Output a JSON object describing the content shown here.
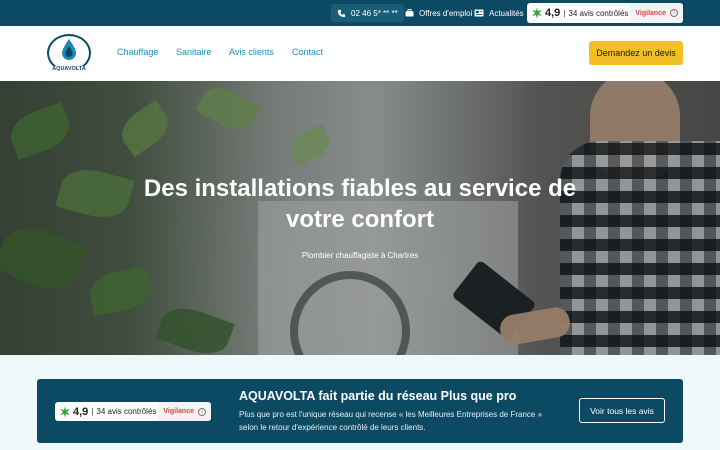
{
  "topbar": {
    "phone": "02 46 5* ** **",
    "jobs_label": "Offres d'emploi",
    "news_label": "Actualités",
    "rating": {
      "score": "4,9",
      "count": "34 avis contrôlés",
      "vigilance": "Vigilance"
    }
  },
  "header": {
    "logo_text": "AQUAVOLTA",
    "nav": [
      "Chauffage",
      "Sanitaire",
      "Avis clients",
      "Contact"
    ],
    "cta_label": "Demandez un devis"
  },
  "hero": {
    "title_line1": "Des installations fiables au service de",
    "title_line2": "votre confort",
    "subtitle": "Plombier chauffagiste à Chartres"
  },
  "network": {
    "rating": {
      "score": "4,9",
      "count": "34 avis contrôlés",
      "vigilance": "Vigilance"
    },
    "title": "AQUAVOLTA fait partie du réseau Plus que pro",
    "text": "Plus que pro est l'unique réseau qui recense « les Meilleures Entreprises de France » selon le retour d'expérience contrôlé de leurs clients.",
    "button_label": "Voir tous les avis"
  },
  "colors": {
    "brand_dark": "#0c4a63",
    "nav_link": "#1e8fb3",
    "cta": "#f2bf28",
    "vigilance": "#d94545",
    "leaf_green": "#3aa346"
  },
  "icons": [
    "phone-icon",
    "briefcase-icon",
    "newspaper-icon",
    "leaf-icon",
    "info-icon",
    "drop-icon"
  ]
}
